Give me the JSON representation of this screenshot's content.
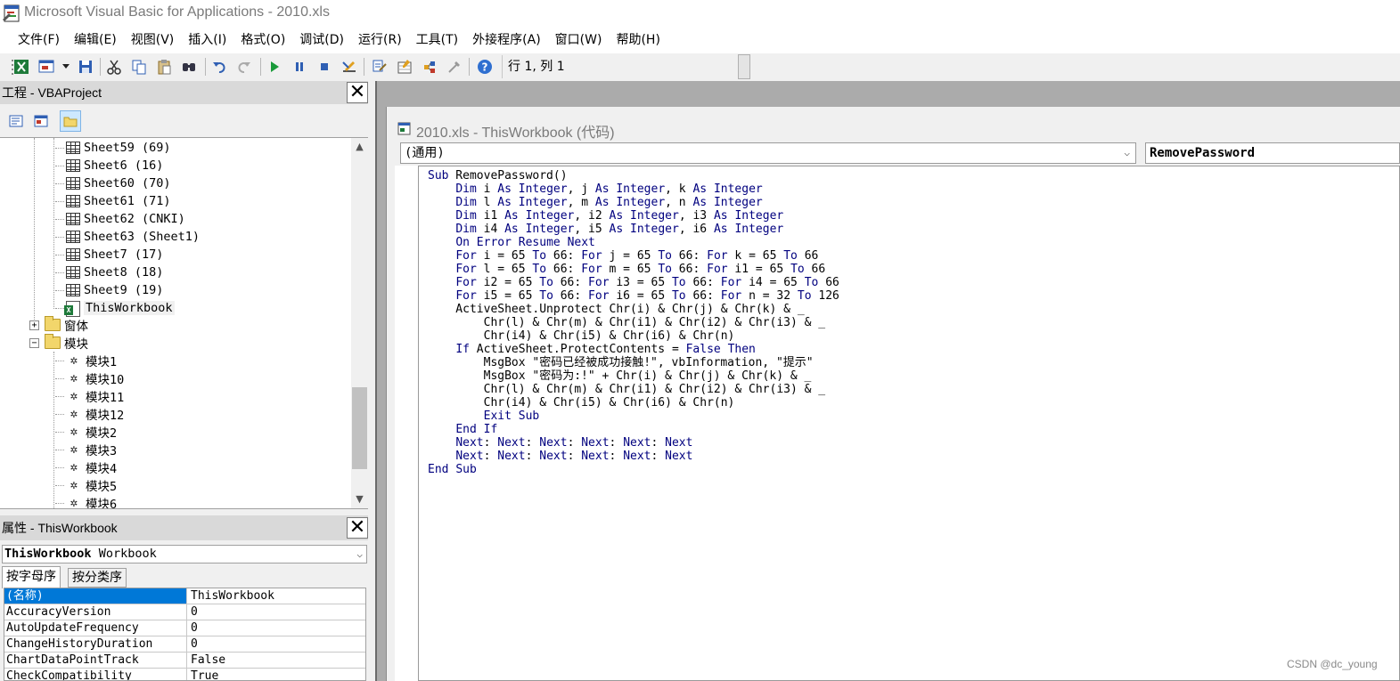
{
  "window": {
    "title": "Microsoft Visual Basic for Applications - 2010.xls"
  },
  "menu": [
    "文件(F)",
    "编辑(E)",
    "视图(V)",
    "插入(I)",
    "格式(O)",
    "调试(D)",
    "运行(R)",
    "工具(T)",
    "外接程序(A)",
    "窗口(W)",
    "帮助(H)"
  ],
  "toolbar": {
    "position": "行 1, 列 1"
  },
  "project": {
    "title": "工程 - VBAProject",
    "tree": [
      {
        "label": "Sheet59 (69)",
        "type": "sheet"
      },
      {
        "label": "Sheet6 (16)",
        "type": "sheet"
      },
      {
        "label": "Sheet60 (70)",
        "type": "sheet"
      },
      {
        "label": "Sheet61 (71)",
        "type": "sheet"
      },
      {
        "label": "Sheet62 (CNKI)",
        "type": "sheet"
      },
      {
        "label": "Sheet63 (Sheet1)",
        "type": "sheet"
      },
      {
        "label": "Sheet7 (17)",
        "type": "sheet"
      },
      {
        "label": "Sheet8 (18)",
        "type": "sheet"
      },
      {
        "label": "Sheet9 (19)",
        "type": "sheet"
      },
      {
        "label": "ThisWorkbook",
        "type": "workbook"
      },
      {
        "label": "窗体",
        "type": "folder"
      },
      {
        "label": "模块",
        "type": "folder-open"
      },
      {
        "label": "模块1",
        "type": "module"
      },
      {
        "label": "模块10",
        "type": "module"
      },
      {
        "label": "模块11",
        "type": "module"
      },
      {
        "label": "模块12",
        "type": "module"
      },
      {
        "label": "模块2",
        "type": "module"
      },
      {
        "label": "模块3",
        "type": "module"
      },
      {
        "label": "模块4",
        "type": "module"
      },
      {
        "label": "模块5",
        "type": "module"
      },
      {
        "label": "模块6",
        "type": "module"
      }
    ]
  },
  "properties": {
    "title": "属性 - ThisWorkbook",
    "object_name": "ThisWorkbook",
    "object_type": "Workbook",
    "tabs": [
      "按字母序",
      "按分类序"
    ],
    "rows": [
      {
        "name": "(名称)",
        "value": "ThisWorkbook"
      },
      {
        "name": "AccuracyVersion",
        "value": "0"
      },
      {
        "name": "AutoUpdateFrequency",
        "value": "0"
      },
      {
        "name": "ChangeHistoryDuration",
        "value": "0"
      },
      {
        "name": "ChartDataPointTrack",
        "value": "False"
      },
      {
        "name": "CheckCompatibility",
        "value": "True"
      }
    ]
  },
  "code_window": {
    "title": "2010.xls - ThisWorkbook (代码)",
    "object_combo": "(通用)",
    "procedure_combo": "RemovePassword",
    "lines": [
      "Sub RemovePassword()",
      "    Dim i As Integer, j As Integer, k As Integer",
      "    Dim l As Integer, m As Integer, n As Integer",
      "    Dim i1 As Integer, i2 As Integer, i3 As Integer",
      "    Dim i4 As Integer, i5 As Integer, i6 As Integer",
      "    On Error Resume Next",
      "    For i = 65 To 66: For j = 65 To 66: For k = 65 To 66",
      "    For l = 65 To 66: For m = 65 To 66: For i1 = 65 To 66",
      "    For i2 = 65 To 66: For i3 = 65 To 66: For i4 = 65 To 66",
      "    For i5 = 65 To 66: For i6 = 65 To 66: For n = 32 To 126",
      "    ActiveSheet.Unprotect Chr(i) & Chr(j) & Chr(k) & _",
      "        Chr(l) & Chr(m) & Chr(i1) & Chr(i2) & Chr(i3) & _",
      "        Chr(i4) & Chr(i5) & Chr(i6) & Chr(n)",
      "    If ActiveSheet.ProtectContents = False Then",
      "        MsgBox \"密码已经被成功接触!\", vbInformation, \"提示\"",
      "        MsgBox \"密码为:!\" + Chr(i) & Chr(j) & Chr(k) & _",
      "        Chr(l) & Chr(m) & Chr(i1) & Chr(i2) & Chr(i3) & _",
      "        Chr(i4) & Chr(i5) & Chr(i6) & Chr(n)",
      "        Exit Sub",
      "    End If",
      "    Next: Next: Next: Next: Next: Next",
      "    Next: Next: Next: Next: Next: Next",
      "End Sub"
    ]
  },
  "watermark": "CSDN @dc_young",
  "colors": {
    "keyword": "#00007f",
    "selection": "#0078d7"
  }
}
